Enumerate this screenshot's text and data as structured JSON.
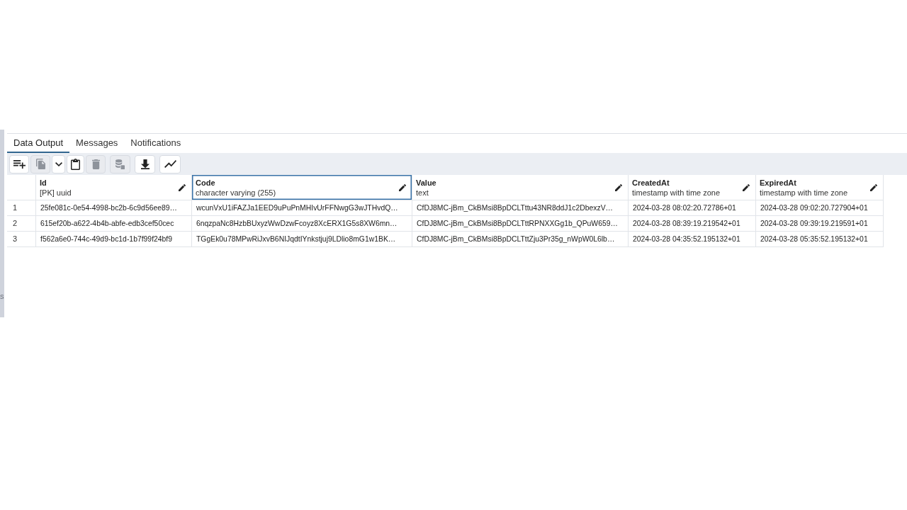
{
  "tabs": [
    {
      "label": "Data Output",
      "selected": true
    },
    {
      "label": "Messages",
      "selected": false
    },
    {
      "label": "Notifications",
      "selected": false
    }
  ],
  "toolbar": {
    "groups": [
      [
        {
          "kind": "add-row",
          "disabled": false
        },
        {
          "kind": "copy",
          "disabled": true
        },
        {
          "kind": "copy-options",
          "disabled": false
        },
        {
          "kind": "paste",
          "disabled": false
        },
        {
          "kind": "delete",
          "disabled": true
        }
      ],
      [
        {
          "kind": "save-data",
          "disabled": true
        }
      ],
      [
        {
          "kind": "download",
          "disabled": false
        }
      ],
      [
        {
          "kind": "graph",
          "disabled": false
        }
      ]
    ]
  },
  "table": {
    "columns": [
      {
        "name": "Id",
        "type": "[PK] uuid",
        "selected": false
      },
      {
        "name": "Code",
        "type": "character varying (255)",
        "selected": true
      },
      {
        "name": "Value",
        "type": "text",
        "selected": false
      },
      {
        "name": "CreatedAt",
        "type": "timestamp with time zone",
        "selected": false
      },
      {
        "name": "ExpiredAt",
        "type": "timestamp with time zone",
        "selected": false
      }
    ],
    "rows": [
      {
        "number": "1",
        "cells": [
          "25fe081c-0e54-4998-bc2b-6c9d56ee89…",
          "wcunVxU1iFAZJa1EED9uPuPnMHIvUrFFNwgG3wJTHvdQ…",
          "CfDJ8MC-jBm_CkBMsi8BpDCLTttu43NR8ddJ1c2DbexzV…",
          "2024-03-28 08:02:20.72786+01",
          "2024-03-28 09:02:20.727904+01"
        ]
      },
      {
        "number": "2",
        "cells": [
          "615ef20b-a622-4b4b-abfe-edb3cef50cec",
          "6nqzpaNc8HzbBUxyzWwDzwFcoyz8XcERX1G5s8XW6mn…",
          "CfDJ8MC-jBm_CkBMsi8BpDCLTttRPNXXGg1b_QPuW659…",
          "2024-03-28 08:39:19.219542+01",
          "2024-03-28 09:39:19.219591+01"
        ]
      },
      {
        "number": "3",
        "cells": [
          "f562a6e0-744c-49d9-bc1d-1b7f99f24bf9",
          "TGgEk0u78MPwRiJxvB6NIJqdtIYnkstjuj9LDlio8mG1w1BK…",
          "CfDJ8MC-jBm_CkBMsi8BpDCLTttZju3Pr35g_nWpW0L6lb…",
          "2024-03-28 04:35:52.195132+01",
          "2024-03-28 05:35:52.195132+01"
        ]
      }
    ]
  },
  "side_panel": {
    "text": "s"
  }
}
